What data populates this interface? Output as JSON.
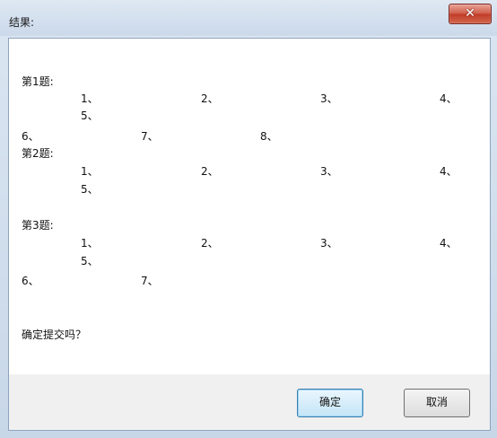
{
  "window": {
    "title": "结果:"
  },
  "titlebar": {
    "close_icon": "close-icon",
    "close_glyph": "✕"
  },
  "results": [
    {
      "heading": "第1题:",
      "items": [
        "1、",
        "2、",
        "3、",
        "4、",
        "5、",
        "6、",
        "7、",
        "8、"
      ]
    },
    {
      "heading": "第2题:",
      "items": [
        "1、",
        "2、",
        "3、",
        "4、",
        "5、"
      ]
    },
    {
      "heading": "第3题:",
      "items": [
        "1、",
        "2、",
        "3、",
        "4、",
        "5、",
        "6、",
        "7、"
      ]
    }
  ],
  "prompt": "确定提交吗？",
  "buttons": {
    "ok": "确定",
    "cancel": "取消"
  }
}
